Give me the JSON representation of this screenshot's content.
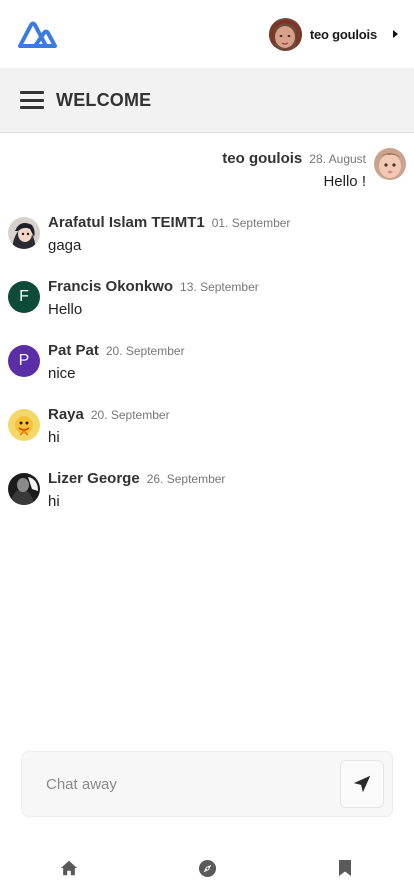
{
  "app": {
    "brand_color": "#3b7be0"
  },
  "user": {
    "name": "teo goulois"
  },
  "header": {
    "title": "WELCOME"
  },
  "messages": [
    {
      "author": "teo goulois",
      "date": "28. August",
      "text": "Hello !",
      "own": true,
      "avatar": "photo-baby"
    },
    {
      "author": "Arafatul Islam TEIMT1",
      "date": "01. September",
      "text": "gaga",
      "avatar": "photo-anime"
    },
    {
      "author": "Francis Okonkwo",
      "date": "13. September",
      "text": "Hello",
      "avatar_letter": "F",
      "avatar_color": "#0f4b3b"
    },
    {
      "author": "Pat Pat",
      "date": "20. September",
      "text": "nice",
      "avatar_letter": "P",
      "avatar_color": "#5a2ea6"
    },
    {
      "author": "Raya",
      "date": "20. September",
      "text": "hi",
      "avatar": "photo-cartoon"
    },
    {
      "author": "Lizer George",
      "date": "26. September",
      "text": "hi",
      "avatar": "photo-dark"
    }
  ],
  "composer": {
    "placeholder": "Chat away"
  },
  "nav": {
    "items": [
      "home-icon",
      "compass-icon",
      "bookmark-icon"
    ]
  }
}
